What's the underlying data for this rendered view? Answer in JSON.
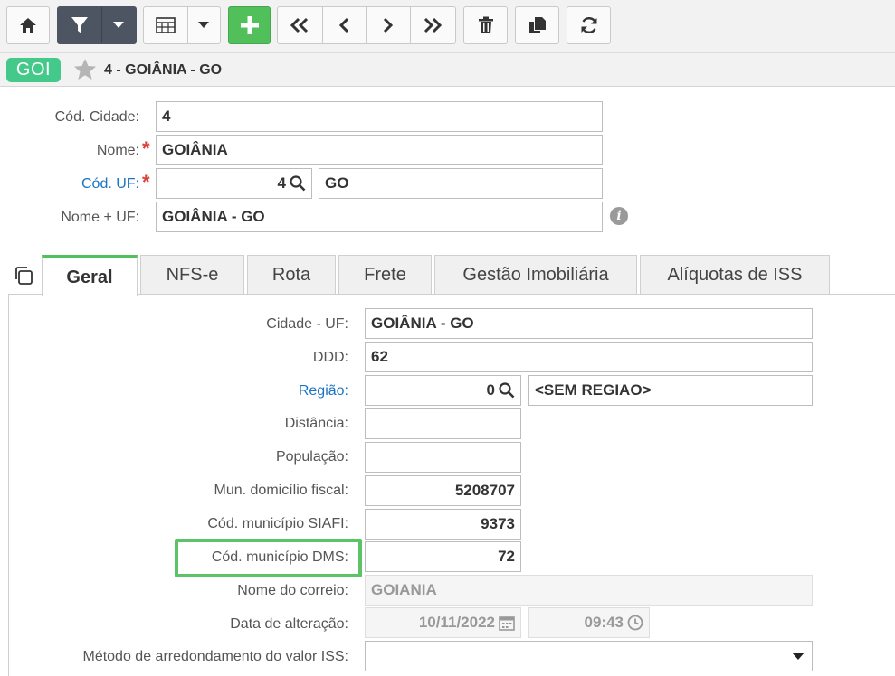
{
  "breadcrumb": {
    "badge": "GOI",
    "title": "4 - GOIÂNIA - GO"
  },
  "form": {
    "cod_cidade": {
      "label": "Cód. Cidade:",
      "value": "4"
    },
    "nome": {
      "label": "Nome:",
      "value": "GOIÂNIA",
      "required": "*"
    },
    "cod_uf": {
      "label": "Cód. UF:",
      "value": "4",
      "desc": "GO",
      "required": "*"
    },
    "nome_uf": {
      "label": "Nome + UF:",
      "value": "GOIÂNIA - GO"
    }
  },
  "tabs": [
    {
      "label": "Geral"
    },
    {
      "label": "NFS-e"
    },
    {
      "label": "Rota"
    },
    {
      "label": "Frete"
    },
    {
      "label": "Gestão Imobiliária"
    },
    {
      "label": "Alíquotas de ISS"
    }
  ],
  "geral": {
    "cidade_uf": {
      "label": "Cidade - UF:",
      "value": "GOIÂNIA - GO"
    },
    "ddd": {
      "label": "DDD:",
      "value": "62"
    },
    "regiao": {
      "label": "Região:",
      "value": "0",
      "desc": "<SEM REGIAO>"
    },
    "distancia": {
      "label": "Distância:",
      "value": ""
    },
    "populacao": {
      "label": "População:",
      "value": ""
    },
    "mun_fiscal": {
      "label": "Mun. domicílio fiscal:",
      "value": "5208707"
    },
    "siafi": {
      "label": "Cód. município SIAFI:",
      "value": "9373"
    },
    "dms": {
      "label": "Cód. município DMS:",
      "value": "72"
    },
    "correio": {
      "label": "Nome do correio:",
      "value": "GOIANIA"
    },
    "data_alteracao": {
      "label": "Data de alteração:",
      "date": "10/11/2022",
      "time": "09:43"
    },
    "metodo_iss": {
      "label": "Método de arredondamento do valor ISS:",
      "value": ""
    }
  },
  "colors": {
    "accent_green": "#52c05a",
    "badge_green": "#45c98a",
    "link_blue": "#1a74c4",
    "required_red": "#d9433a",
    "toolbar_dark": "#4c5561"
  }
}
